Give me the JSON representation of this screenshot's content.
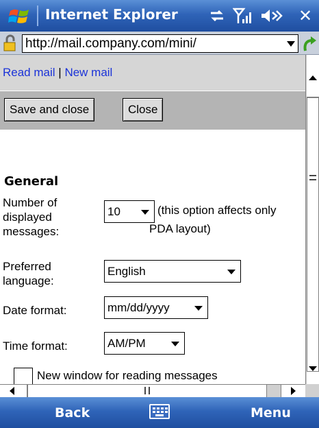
{
  "titlebar": {
    "title": "Internet Explorer",
    "icons": [
      "windows-flag-icon",
      "connectivity-icon",
      "signal-icon",
      "volume-icon",
      "close-icon"
    ]
  },
  "address": {
    "url": "http://mail.company.com/mini/",
    "icons": [
      "lock-icon",
      "dropdown-icon",
      "go-arrow-icon"
    ]
  },
  "nav": {
    "read_mail": "Read mail",
    "separator": "|",
    "new_mail": "New mail"
  },
  "toolbar": {
    "save_close_label": "Save and close",
    "close_label": "Close"
  },
  "settings": {
    "section_title": "General",
    "messages": {
      "label_line1": "Number of",
      "label_line2": "displayed",
      "label_line3": "messages:",
      "value": "10",
      "hint_line1": "(this option affects only",
      "hint_line2": "PDA layout)"
    },
    "language": {
      "label_line1": "Preferred",
      "label_line2": "language:",
      "value": "English"
    },
    "date_format": {
      "label": "Date format:",
      "value": "mm/dd/yyyy"
    },
    "time_format": {
      "label": "Time format:",
      "value": "AM/PM"
    },
    "new_window": {
      "label": "New window for reading messages",
      "checked": false
    }
  },
  "softkeys": {
    "left": "Back",
    "right": "Menu",
    "center_icon": "keyboard-icon"
  },
  "colors": {
    "bar_blue": "#2f64b8",
    "link_blue": "#1b33d8",
    "nav_gray": "#d6d6d6",
    "toolbar_gray": "#b4b4b4"
  }
}
